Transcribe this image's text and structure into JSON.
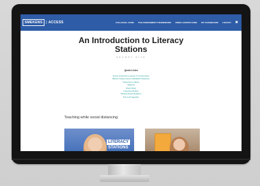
{
  "header": {
    "logo_brand": "SMEKENS",
    "logo_separator": "|",
    "logo_product": "ACCESS",
    "nav": [
      "COLLEGIAL CODE",
      "TAN ASSESSMENT FRAMEWORK",
      "VIDEO LESSON CODE",
      "MY DASHBOARD",
      "LOGOUT",
      "✖"
    ],
    "brand_color": "#2e5ca7"
  },
  "page": {
    "title_line1": "An Introduction to Literacy",
    "title_line2": "Stations",
    "subtitle": "SECRET SITE"
  },
  "quick_links": {
    "title": "Quick Links",
    "items": [
      "Focus Instruction Lesson 3 Construction",
      "Before Clarity How to Establish Routines",
      "Classroom Library",
      "Stations",
      "Word Work",
      "Listening Station",
      "Writing Areas Readers",
      "Put It all Together"
    ],
    "link_color": "#1f9d9b"
  },
  "section": {
    "heading": "Teaching while social distancing"
  },
  "videos": [
    {
      "overlay_line1": "LITERACY",
      "overlay_line2": "STATIONS"
    },
    {
      "overlay_line1": "",
      "overlay_line2": ""
    }
  ]
}
